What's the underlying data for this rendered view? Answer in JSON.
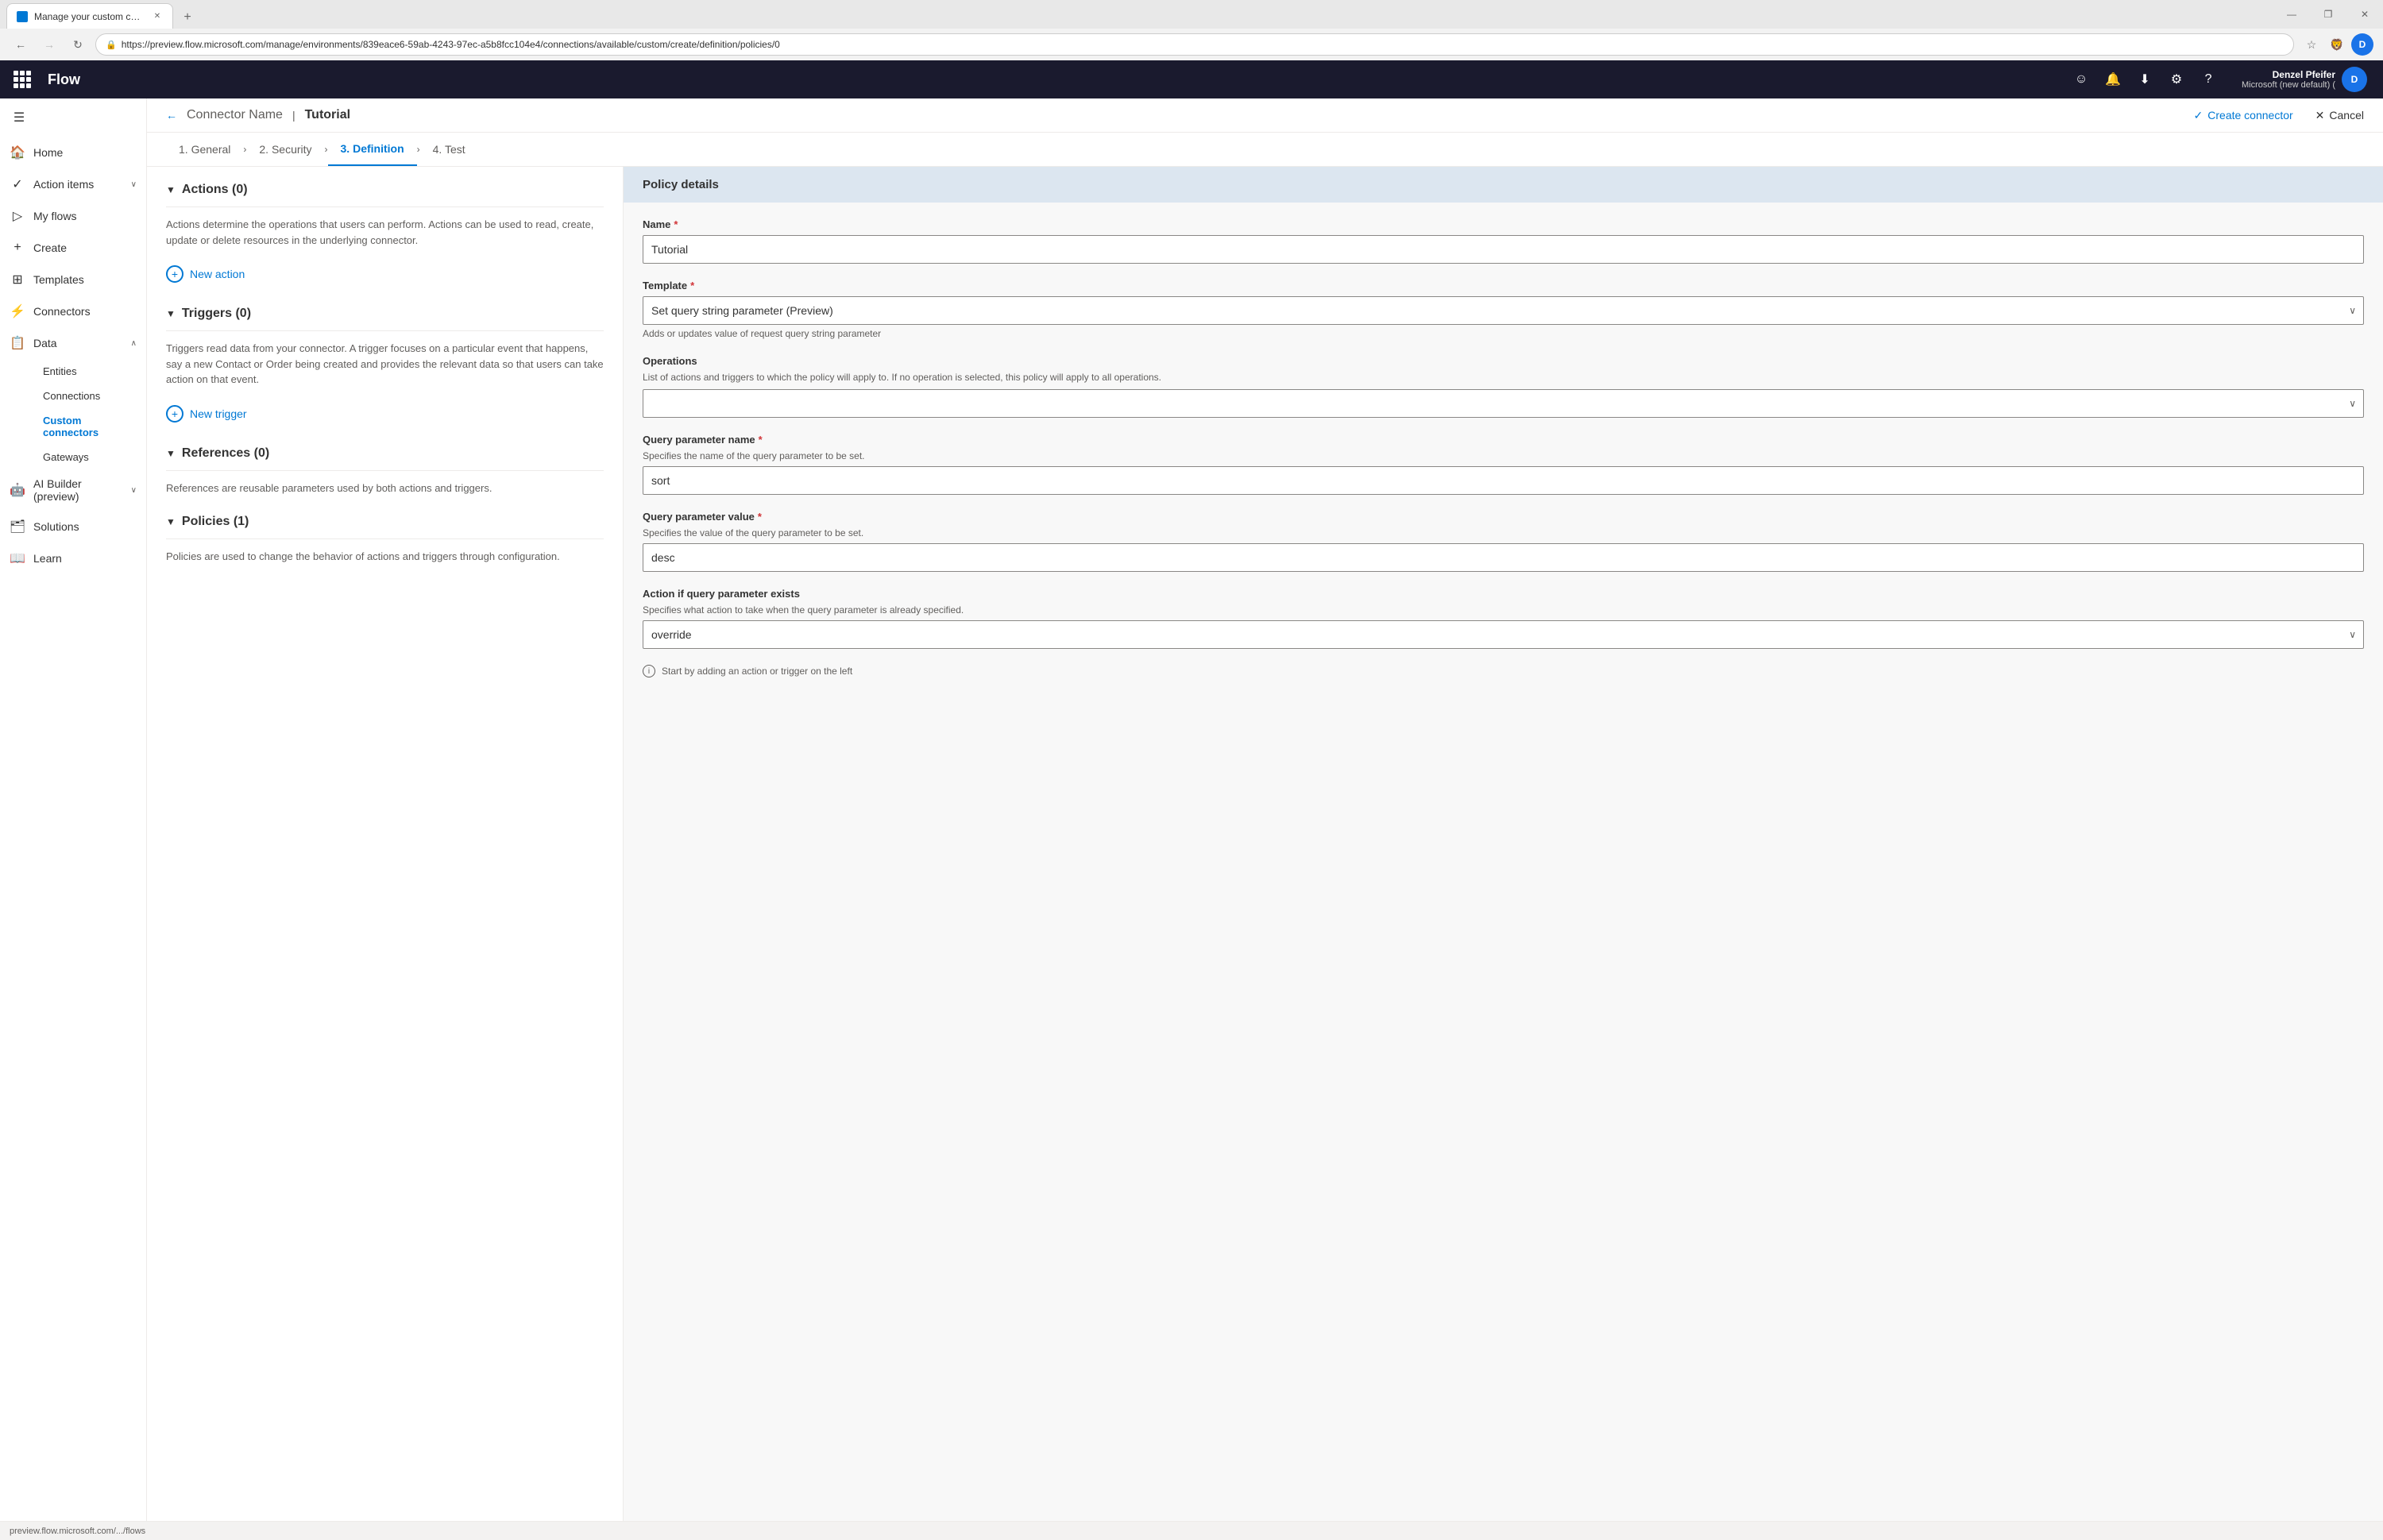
{
  "browser": {
    "tab_title": "Manage your custom connectors",
    "url": "https://preview.flow.microsoft.com/manage/environments/839eace6-59ab-4243-97ec-a5b8fcc104e4/connections/available/custom/create/definition/policies/0",
    "status_bar": "preview.flow.microsoft.com/.../flows",
    "window_controls": {
      "minimize": "—",
      "maximize": "❐",
      "close": "✕"
    }
  },
  "app_header": {
    "title": "Flow",
    "user_name": "Denzel Pfeifer",
    "user_org": "Microsoft (new default) (",
    "user_initials": "D",
    "icons": {
      "emoji": "☺",
      "bell": "🔔",
      "download": "⬇",
      "settings": "⚙",
      "help": "?"
    }
  },
  "top_nav": {
    "back_label": "←",
    "connector_name": "Connector Name",
    "separator": ">",
    "page_title": "Tutorial",
    "create_connector_label": "Create connector",
    "cancel_label": "Cancel"
  },
  "step_nav": {
    "steps": [
      {
        "id": "general",
        "label": "1. General",
        "active": false
      },
      {
        "id": "security",
        "label": "2. Security",
        "active": false
      },
      {
        "id": "definition",
        "label": "3. Definition",
        "active": true
      },
      {
        "id": "test",
        "label": "4. Test",
        "active": false
      }
    ]
  },
  "sidebar": {
    "menu_icon": "☰",
    "items": [
      {
        "id": "home",
        "label": "Home",
        "icon": "🏠"
      },
      {
        "id": "action-items",
        "label": "Action items",
        "icon": "✓",
        "has_chevron": true
      },
      {
        "id": "my-flows",
        "label": "My flows",
        "icon": "▷"
      },
      {
        "id": "create",
        "label": "Create",
        "icon": "+"
      },
      {
        "id": "templates",
        "label": "Templates",
        "icon": "⊞"
      },
      {
        "id": "connectors",
        "label": "Connectors",
        "icon": "⚡"
      },
      {
        "id": "data",
        "label": "Data",
        "icon": "📋",
        "has_chevron": true,
        "expanded": true
      },
      {
        "id": "ai-builder",
        "label": "AI Builder (preview)",
        "icon": "🤖",
        "has_chevron": true
      },
      {
        "id": "solutions",
        "label": "Solutions",
        "icon": "🗂"
      },
      {
        "id": "learn",
        "label": "Learn",
        "icon": "📖"
      }
    ],
    "sub_items": [
      {
        "id": "entities",
        "label": "Entities"
      },
      {
        "id": "connections",
        "label": "Connections"
      },
      {
        "id": "custom-connectors",
        "label": "Custom connectors",
        "active": true
      },
      {
        "id": "gateways",
        "label": "Gateways"
      }
    ]
  },
  "left_panel": {
    "sections": [
      {
        "id": "actions",
        "title": "Actions (0)",
        "description": "Actions determine the operations that users can perform. Actions can be used to read, create, update or delete resources in the underlying connector.",
        "action_label": "New action"
      },
      {
        "id": "triggers",
        "title": "Triggers (0)",
        "description": "Triggers read data from your connector. A trigger focuses on a particular event that happens, say a new Contact or Order being created and provides the relevant data so that users can take action on that event.",
        "action_label": "New trigger"
      },
      {
        "id": "references",
        "title": "References (0)",
        "description": "References are reusable parameters used by both actions and triggers."
      },
      {
        "id": "policies",
        "title": "Policies (1)",
        "description": "Policies are used to change the behavior of actions and triggers through configuration."
      }
    ]
  },
  "right_panel": {
    "header": "Policy details",
    "form": {
      "name_label": "Name",
      "name_required": true,
      "name_value": "Tutorial",
      "template_label": "Template",
      "template_required": true,
      "template_value": "Set query string parameter (Preview)",
      "template_description": "Adds or updates value of request query string parameter",
      "operations_label": "Operations",
      "operations_hint": "List of actions and triggers to which the policy will apply to. If no operation is selected, this policy will apply to all operations.",
      "query_param_name_label": "Query parameter name",
      "query_param_name_required": true,
      "query_param_name_hint": "Specifies the name of the query parameter to be set.",
      "query_param_name_value": "sort",
      "query_param_value_label": "Query parameter value",
      "query_param_value_required": true,
      "query_param_value_hint": "Specifies the value of the query parameter to be set.",
      "query_param_value_value": "desc",
      "action_if_exists_label": "Action if query parameter exists",
      "action_if_exists_hint": "Specifies what action to take when the query parameter is already specified.",
      "action_if_exists_value": "override",
      "start_hint": "Start by adding an action or trigger on the left"
    }
  }
}
